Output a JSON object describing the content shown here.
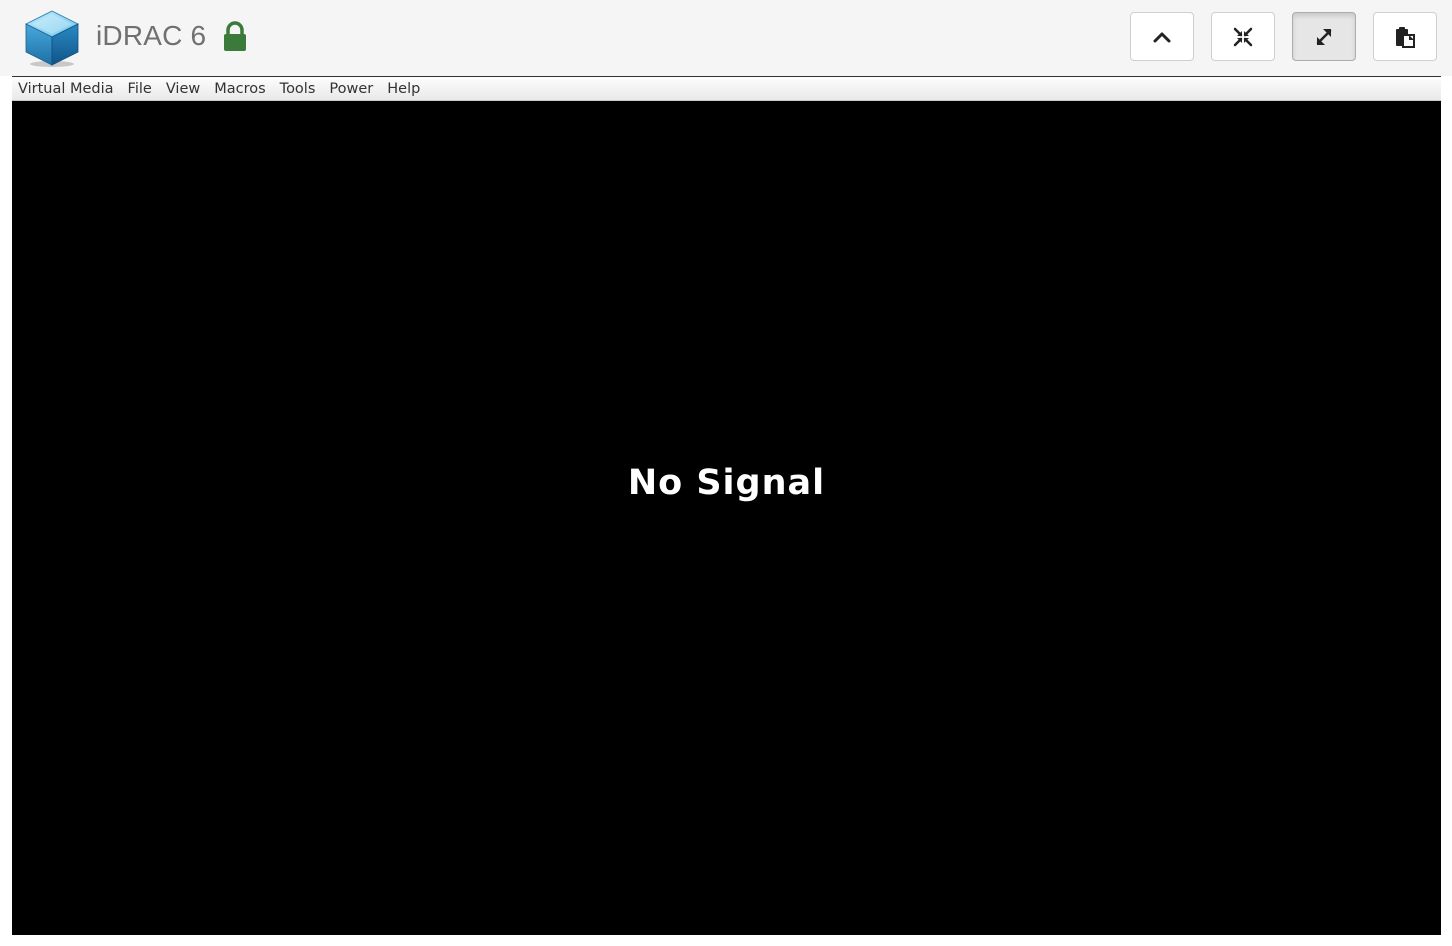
{
  "app": {
    "title": "iDRAC 6",
    "logo_icon": "cube-logo-icon",
    "secure_icon": "lock-icon",
    "lock_color": "#3c7a3c"
  },
  "toolbar": {
    "buttons": [
      {
        "name": "collapse",
        "icon": "chevron-up-icon",
        "active": false
      },
      {
        "name": "fullscreen",
        "icon": "compress-icon",
        "active": false
      },
      {
        "name": "scale-to-fit",
        "icon": "expand-arrows-icon",
        "active": true
      },
      {
        "name": "clipboard",
        "icon": "clipboard-icon",
        "active": false
      }
    ]
  },
  "menubar": {
    "items": [
      "Virtual Media",
      "File",
      "View",
      "Macros",
      "Tools",
      "Power",
      "Help"
    ]
  },
  "console": {
    "message": "No Signal",
    "background": "#000000",
    "text_color": "#ffffff"
  }
}
